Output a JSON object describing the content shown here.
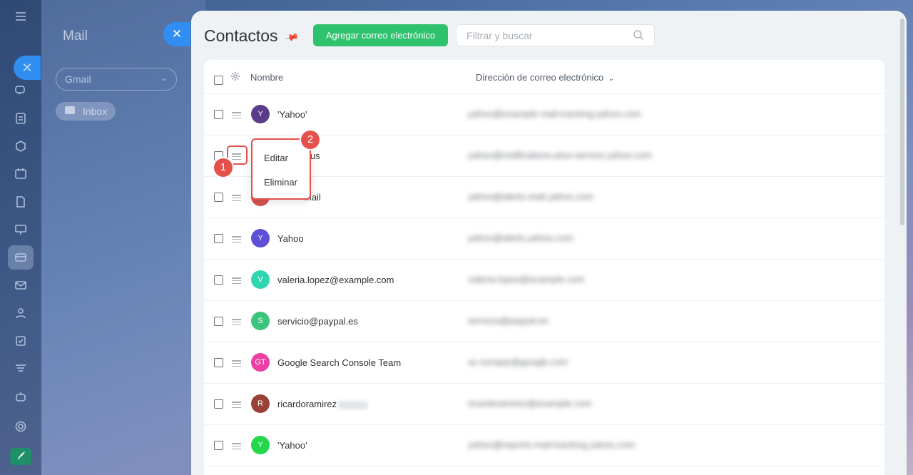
{
  "rail": {
    "icons": [
      "close-icon",
      "chat-icon",
      "feed-icon",
      "hexagon-icon",
      "calendar-icon",
      "document-icon",
      "presentation-icon",
      "crm-icon",
      "mail-icon",
      "contacts-icon",
      "tasks-icon",
      "filter-icon",
      "robot-icon",
      "settings-icon",
      "rocket-icon"
    ]
  },
  "mail_panel": {
    "title": "Mail",
    "mailbox_select": "Gmail",
    "inbox_label": "Inbox"
  },
  "header": {
    "title": "Contactos",
    "add_button": "Agregar correo electrónico",
    "search_placeholder": "Filtrar y buscar"
  },
  "table": {
    "columns": {
      "name": "Nombre",
      "email": "Dirección de correo electrónico"
    },
    "rows": [
      {
        "initial": "Y",
        "name": "'Yahoo'",
        "email": "yahoo@example-mail-tracking.yahoo.com",
        "color": "#5b3a8a"
      },
      {
        "initial": "",
        "name": "lus",
        "email": "yahoo@notifications-plus-service.yahoo.com",
        "color": "#7a4fb0"
      },
      {
        "initial": "",
        "name": "Mail",
        "email": "yahoo@alerts-mail.yahoo.com",
        "color": "#d9534f"
      },
      {
        "initial": "Y",
        "name": "Yahoo",
        "email": "yahoo@alerts.yahoo.com",
        "color": "#5d4fd6"
      },
      {
        "initial": "V",
        "name": "valeria.lopez@example.com",
        "email": "valeria.lopez@example.com",
        "color": "#2fd6b0"
      },
      {
        "initial": "S",
        "name": "servicio@paypal.es",
        "email": "servicio@paypal.es",
        "color": "#3cc47c"
      },
      {
        "initial": "GT",
        "name": "Google Search Console Team",
        "email": "sc-noreply@google.com",
        "color": "#ee3fa4"
      },
      {
        "initial": "R",
        "name": "ricardoramirez",
        "email": "ricardoramirez@example.com",
        "color": "#9b4038"
      },
      {
        "initial": "Y",
        "name": "'Yahoo'",
        "email": "yahoo@reports-mail-tracking.yahoo.com",
        "color": "#22d84a"
      }
    ]
  },
  "context_menu": {
    "edit": "Editar",
    "delete": "Eliminar"
  },
  "markers": {
    "one": "1",
    "two": "2"
  },
  "colors": {
    "accent_green": "#2fc26e",
    "accent_blue": "#2f8ef0",
    "marker_red": "#e4514c"
  }
}
